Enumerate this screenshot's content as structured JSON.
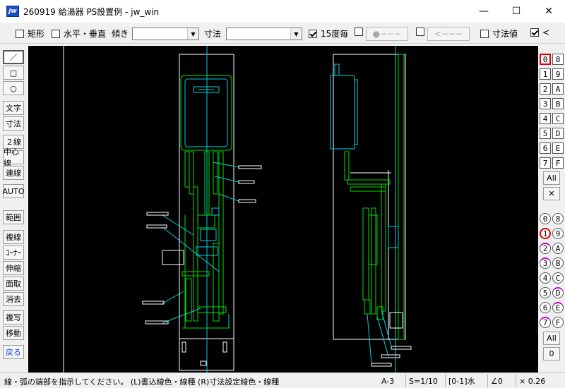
{
  "window": {
    "title": "260919 給湯器 PS設置例 - jw_win",
    "app_icon_text": "jw",
    "minimize": "—",
    "maximize": "☐",
    "close": "✕"
  },
  "toolbar": {
    "rect_label": "矩形",
    "hv_label": "水平・垂直",
    "angle_label": "傾き",
    "dim_label": "寸法",
    "deg15_label": "15度毎",
    "circle_btn": "●−−−",
    "arrow_btn": "<−−−",
    "dimvalue_label": "寸法値",
    "lt_label": "<"
  },
  "leftbar": {
    "line": "／",
    "rect": "□",
    "circle": "○",
    "text": "文字",
    "dim": "寸法",
    "double_line": "２線",
    "center_line": "中心線",
    "continuous_line": "連線",
    "auto": "AUTO",
    "range": "範囲",
    "multi_line": "複線",
    "corner": "ｺｰﾅｰ",
    "stretch": "伸縮",
    "chamfer": "面取",
    "erase": "消去",
    "copy": "複写",
    "move": "移動",
    "undo": "戻る"
  },
  "rightbar": {
    "layers_square": [
      "0",
      "8",
      "1",
      "9",
      "2",
      "A",
      "3",
      "B",
      "4",
      "C",
      "5",
      "D",
      "6",
      "E",
      "7",
      "F"
    ],
    "all1": "All",
    "cross": "✕",
    "groups_circle": [
      "0",
      "8",
      "1",
      "9",
      "2",
      "A",
      "3",
      "B",
      "4",
      "C",
      "5",
      "D",
      "6",
      "E",
      "7",
      "F"
    ],
    "all2": "All",
    "zero": "0"
  },
  "status": {
    "message": "線・弧の端部を指示してください。 (L)書込線色・線種 (R)寸法設定線色・線種",
    "paper": "A-3",
    "scale": "S=1/10",
    "layer": "[0-1]水",
    "angle": "∠0",
    "zoom": "× 0.26"
  },
  "colors": {
    "drawing_line": "#00e000",
    "aux_line": "#00d0e0",
    "white_line": "#ffffff",
    "canvas_bg": "#000000"
  }
}
